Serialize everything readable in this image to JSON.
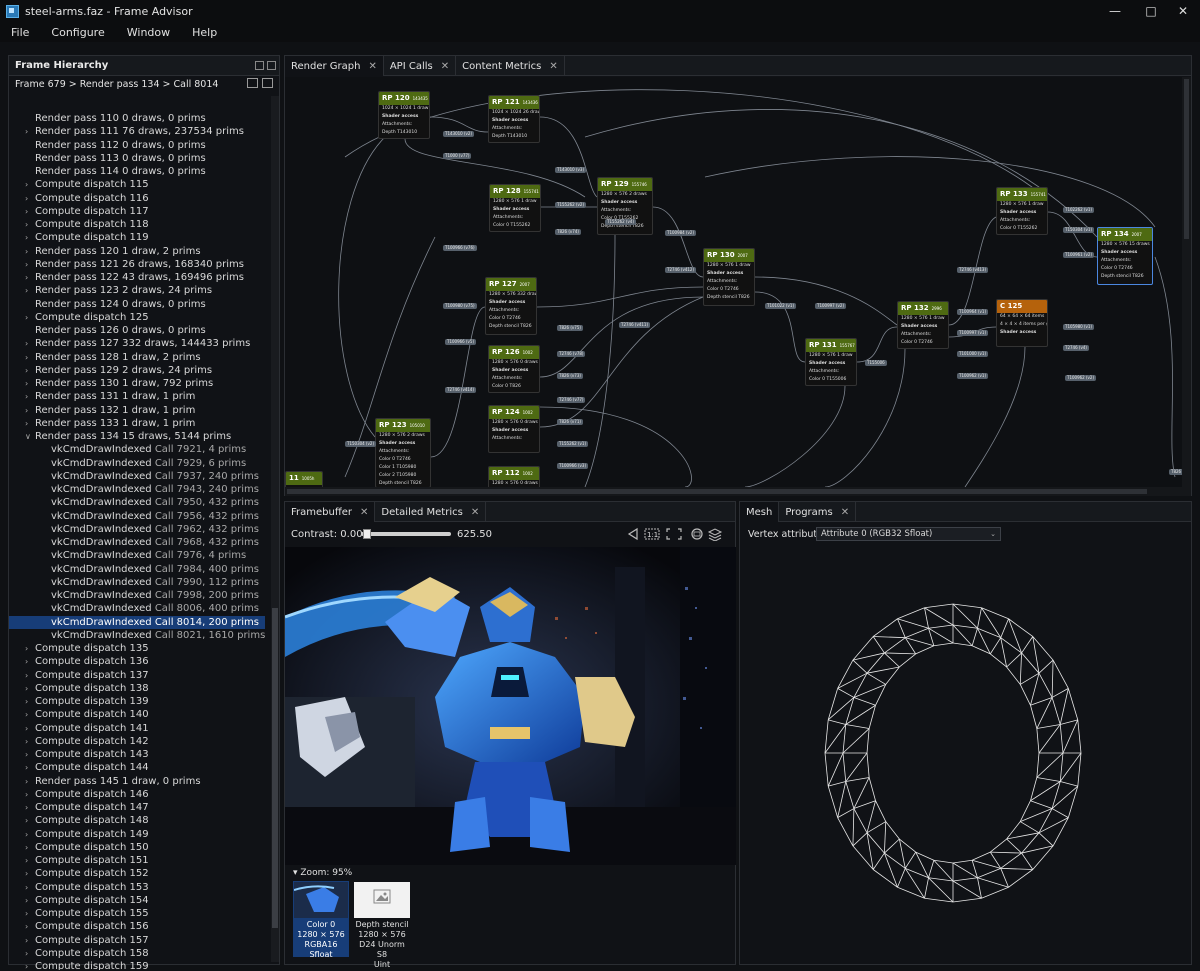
{
  "window": {
    "title": "steel-arms.faz - Frame Advisor"
  },
  "menu": [
    "File",
    "Configure",
    "Window",
    "Help"
  ],
  "hierarchy": {
    "title": "Frame Hierarchy",
    "breadcrumb": "Frame 679 > Render pass 134 > Call 8014",
    "rows": [
      {
        "label": "Render pass 110",
        "detail": "0 draws, 0 prims",
        "indent": 1,
        "expander": false
      },
      {
        "label": "Render pass 111",
        "detail": "76 draws, 237534 prims",
        "indent": 1,
        "expander": true
      },
      {
        "label": "Render pass 112",
        "detail": "0 draws, 0 prims",
        "indent": 1,
        "expander": false
      },
      {
        "label": "Render pass 113",
        "detail": "0 draws, 0 prims",
        "indent": 1,
        "expander": false
      },
      {
        "label": "Render pass 114",
        "detail": "0 draws, 0 prims",
        "indent": 1,
        "expander": false
      },
      {
        "label": "Compute dispatch 115",
        "detail": "",
        "indent": 1,
        "expander": true
      },
      {
        "label": "Compute dispatch 116",
        "detail": "",
        "indent": 1,
        "expander": true
      },
      {
        "label": "Compute dispatch 117",
        "detail": "",
        "indent": 1,
        "expander": true
      },
      {
        "label": "Compute dispatch 118",
        "detail": "",
        "indent": 1,
        "expander": true
      },
      {
        "label": "Compute dispatch 119",
        "detail": "",
        "indent": 1,
        "expander": true
      },
      {
        "label": "Render pass 120",
        "detail": "1 draw, 2 prims",
        "indent": 1,
        "expander": true
      },
      {
        "label": "Render pass 121",
        "detail": "26 draws, 168340 prims",
        "indent": 1,
        "expander": true
      },
      {
        "label": "Render pass 122",
        "detail": "43 draws, 169496 prims",
        "indent": 1,
        "expander": true
      },
      {
        "label": "Render pass 123",
        "detail": "2 draws, 24 prims",
        "indent": 1,
        "expander": true
      },
      {
        "label": "Render pass 124",
        "detail": "0 draws, 0 prims",
        "indent": 1,
        "expander": false
      },
      {
        "label": "Compute dispatch 125",
        "detail": "",
        "indent": 1,
        "expander": true
      },
      {
        "label": "Render pass 126",
        "detail": "0 draws, 0 prims",
        "indent": 1,
        "expander": false
      },
      {
        "label": "Render pass 127",
        "detail": "332 draws, 144433 prims",
        "indent": 1,
        "expander": true
      },
      {
        "label": "Render pass 128",
        "detail": "1 draw, 2 prims",
        "indent": 1,
        "expander": true
      },
      {
        "label": "Render pass 129",
        "detail": "2 draws, 24 prims",
        "indent": 1,
        "expander": true
      },
      {
        "label": "Render pass 130",
        "detail": "1 draw, 792 prims",
        "indent": 1,
        "expander": true
      },
      {
        "label": "Render pass 131",
        "detail": "1 draw, 1 prim",
        "indent": 1,
        "expander": true
      },
      {
        "label": "Render pass 132",
        "detail": "1 draw, 1 prim",
        "indent": 1,
        "expander": true
      },
      {
        "label": "Render pass 133",
        "detail": "1 draw, 1 prim",
        "indent": 1,
        "expander": true
      },
      {
        "label": "Render pass 134",
        "detail": "15 draws, 5144 prims",
        "indent": 1,
        "expander": "open"
      },
      {
        "label": "vkCmdDrawIndexed",
        "detail": "Call 7921, 4 prims",
        "indent": 2,
        "expander": false
      },
      {
        "label": "vkCmdDrawIndexed",
        "detail": "Call 7929, 6 prims",
        "indent": 2,
        "expander": false
      },
      {
        "label": "vkCmdDrawIndexed",
        "detail": "Call 7937, 240 prims",
        "indent": 2,
        "expander": false
      },
      {
        "label": "vkCmdDrawIndexed",
        "detail": "Call 7943, 240 prims",
        "indent": 2,
        "expander": false
      },
      {
        "label": "vkCmdDrawIndexed",
        "detail": "Call 7950, 432 prims",
        "indent": 2,
        "expander": false
      },
      {
        "label": "vkCmdDrawIndexed",
        "detail": "Call 7956, 432 prims",
        "indent": 2,
        "expander": false
      },
      {
        "label": "vkCmdDrawIndexed",
        "detail": "Call 7962, 432 prims",
        "indent": 2,
        "expander": false
      },
      {
        "label": "vkCmdDrawIndexed",
        "detail": "Call 7968, 432 prims",
        "indent": 2,
        "expander": false
      },
      {
        "label": "vkCmdDrawIndexed",
        "detail": "Call 7976, 4 prims",
        "indent": 2,
        "expander": false
      },
      {
        "label": "vkCmdDrawIndexed",
        "detail": "Call 7984, 400 prims",
        "indent": 2,
        "expander": false
      },
      {
        "label": "vkCmdDrawIndexed",
        "detail": "Call 7990, 112 prims",
        "indent": 2,
        "expander": false
      },
      {
        "label": "vkCmdDrawIndexed",
        "detail": "Call 7998, 200 prims",
        "indent": 2,
        "expander": false
      },
      {
        "label": "vkCmdDrawIndexed",
        "detail": "Call 8006, 400 prims",
        "indent": 2,
        "expander": false
      },
      {
        "label": "vkCmdDrawIndexed",
        "detail": "Call 8014, 200 prims",
        "indent": 2,
        "expander": false,
        "selected": true
      },
      {
        "label": "vkCmdDrawIndexed",
        "detail": "Call 8021, 1610 prims",
        "indent": 2,
        "expander": false
      },
      {
        "label": "Compute dispatch 135",
        "detail": "",
        "indent": 1,
        "expander": true
      },
      {
        "label": "Compute dispatch 136",
        "detail": "",
        "indent": 1,
        "expander": true
      },
      {
        "label": "Compute dispatch 137",
        "detail": "",
        "indent": 1,
        "expander": true
      },
      {
        "label": "Compute dispatch 138",
        "detail": "",
        "indent": 1,
        "expander": true
      },
      {
        "label": "Compute dispatch 139",
        "detail": "",
        "indent": 1,
        "expander": true
      },
      {
        "label": "Compute dispatch 140",
        "detail": "",
        "indent": 1,
        "expander": true
      },
      {
        "label": "Compute dispatch 141",
        "detail": "",
        "indent": 1,
        "expander": true
      },
      {
        "label": "Compute dispatch 142",
        "detail": "",
        "indent": 1,
        "expander": true
      },
      {
        "label": "Compute dispatch 143",
        "detail": "",
        "indent": 1,
        "expander": true
      },
      {
        "label": "Compute dispatch 144",
        "detail": "",
        "indent": 1,
        "expander": true
      },
      {
        "label": "Render pass 145",
        "detail": "1 draw, 0 prims",
        "indent": 1,
        "expander": true
      },
      {
        "label": "Compute dispatch 146",
        "detail": "",
        "indent": 1,
        "expander": true
      },
      {
        "label": "Compute dispatch 147",
        "detail": "",
        "indent": 1,
        "expander": true
      },
      {
        "label": "Compute dispatch 148",
        "detail": "",
        "indent": 1,
        "expander": true
      },
      {
        "label": "Compute dispatch 149",
        "detail": "",
        "indent": 1,
        "expander": true
      },
      {
        "label": "Compute dispatch 150",
        "detail": "",
        "indent": 1,
        "expander": true
      },
      {
        "label": "Compute dispatch 151",
        "detail": "",
        "indent": 1,
        "expander": true
      },
      {
        "label": "Compute dispatch 152",
        "detail": "",
        "indent": 1,
        "expander": true
      },
      {
        "label": "Compute dispatch 153",
        "detail": "",
        "indent": 1,
        "expander": true
      },
      {
        "label": "Compute dispatch 154",
        "detail": "",
        "indent": 1,
        "expander": true
      },
      {
        "label": "Compute dispatch 155",
        "detail": "",
        "indent": 1,
        "expander": true
      },
      {
        "label": "Compute dispatch 156",
        "detail": "",
        "indent": 1,
        "expander": true
      },
      {
        "label": "Compute dispatch 157",
        "detail": "",
        "indent": 1,
        "expander": true
      },
      {
        "label": "Compute dispatch 158",
        "detail": "",
        "indent": 1,
        "expander": true
      },
      {
        "label": "Compute dispatch 159",
        "detail": "",
        "indent": 1,
        "expander": true
      }
    ]
  },
  "graph_tabs": [
    "Render Graph",
    "API Calls",
    "Content Metrics"
  ],
  "graph_nodes": [
    {
      "id": "n120",
      "title": "RP 120",
      "sub": "143435",
      "kind": "rp",
      "lines": [
        "1024 × 1024   1 draw",
        "Shader access",
        "Attachments:",
        "Depth      T143010"
      ]
    },
    {
      "id": "n121",
      "title": "RP 121",
      "sub": "143436",
      "kind": "rp",
      "lines": [
        "1024 × 1024   26 draws",
        "Shader access",
        "Attachments:",
        "Depth      T143010"
      ]
    },
    {
      "id": "n128",
      "title": "RP 128",
      "sub": "155741",
      "kind": "rp",
      "lines": [
        "1280 × 576   1 draw",
        "Shader access",
        "Attachments:",
        "Color 0    T155262"
      ]
    },
    {
      "id": "n129",
      "title": "RP 129",
      "sub": "155746",
      "kind": "rp",
      "lines": [
        "1280 × 576   2 draws",
        "Shader access",
        "Attachments:",
        "Color 0    T155262",
        "Depth stencil  T826"
      ]
    },
    {
      "id": "n133",
      "title": "RP 133",
      "sub": "155741",
      "kind": "rp",
      "lines": [
        "1280 × 576   1 draw",
        "Shader access",
        "Attachments:",
        "Color 0    T155262"
      ]
    },
    {
      "id": "n134",
      "title": "RP 134",
      "sub": "2007",
      "kind": "rp",
      "lines": [
        "1280 × 576   15 draws",
        "Shader access",
        "Attachments:",
        "Color 0    T2746",
        "Depth stencil  T826"
      ]
    },
    {
      "id": "n130",
      "title": "RP 130",
      "sub": "2007",
      "kind": "rp",
      "lines": [
        "1280 × 576   1 draw",
        "Shader access",
        "Attachments:",
        "Color 0    T2746",
        "Depth stencil  T826"
      ]
    },
    {
      "id": "n127",
      "title": "RP 127",
      "sub": "2007",
      "kind": "rp",
      "lines": [
        "1280 × 576   332 draws",
        "Shader access",
        "Attachments:",
        "Color 0    T2746",
        "Depth stencil  T826"
      ]
    },
    {
      "id": "n126",
      "title": "RP 126",
      "sub": "1002",
      "kind": "rp",
      "lines": [
        "1280 × 576   0 draws",
        "Shader access",
        "Attachments:",
        "Color 0    T826"
      ]
    },
    {
      "id": "n124",
      "title": "RP 124",
      "sub": "1002",
      "kind": "rp",
      "lines": [
        "1280 × 576   0 draws",
        "Shader access",
        "Attachments:"
      ]
    },
    {
      "id": "n112",
      "title": "RP 112",
      "sub": "1002",
      "kind": "rp",
      "lines": [
        "1280 × 576   0 draws",
        "Shader access"
      ]
    },
    {
      "id": "n132",
      "title": "RP 132",
      "sub": "2996",
      "kind": "rp",
      "lines": [
        "1280 × 576   1 draw",
        "Shader access",
        "Attachments:",
        "Color 0    T2746"
      ]
    },
    {
      "id": "n131",
      "title": "RP 131",
      "sub": "155767",
      "kind": "rp",
      "lines": [
        "1280 × 576   1 draw",
        "Shader access",
        "Attachments:",
        "Color 0    T155006"
      ]
    },
    {
      "id": "n125",
      "title": "C 125",
      "sub": "",
      "kind": "cd",
      "lines": [
        "64 × 64 × 64 items",
        "4 × 4 × 4 items per group",
        "Shader access"
      ]
    },
    {
      "id": "n123",
      "title": "RP 123",
      "sub": "105010",
      "kind": "rp",
      "lines": [
        "1280 × 576   2 draws",
        "Shader access",
        "Attachments:",
        "Color 0    T2746",
        "Color 1    T105980",
        "Color 2    T105980",
        "Depth stencil  T826"
      ]
    },
    {
      "id": "n11",
      "title": "11",
      "sub": "1005h",
      "kind": "rp",
      "lines": []
    }
  ],
  "graph_labels": [
    "T143010 (v2)",
    "T1000 (v77)",
    "T143010 (v3)",
    "T155262 (v2)",
    "T826 (v74)",
    "T155262 (v4)",
    "T100966 (v76)",
    "T2746 (v412)",
    "T100980 (v75)",
    "T2746 (v411)",
    "T826 (v75)",
    "T2746 (v78)",
    "T826 (v73)",
    "T2746 (v77)",
    "T826 (v71)",
    "T155262 (v1)",
    "T100966 (v3)",
    "T155006",
    "T2746 (v413)",
    "T102262 (v1)",
    "T150304 (v1)",
    "T100961 (v2)",
    "T100964 (v1)",
    "T100997 (v1)",
    "T101000 (v1)",
    "T100962 (v1)",
    "T105980 (v1)",
    "T2746 (v4)",
    "T100962 (v2)",
    "T101022 (v1)",
    "T100997 (v2)",
    "T100966 (v5)",
    "T2746 (v414)",
    "T100984 (v2)",
    "T150304 (v2)",
    "T826 (v77)"
  ],
  "framebuffer": {
    "tabs": [
      "Framebuffer",
      "Detailed Metrics"
    ],
    "contrast_label": "Contrast:",
    "contrast_min": "0.00",
    "contrast_max": "625.50",
    "contrast_fraction": 0.04,
    "zoom": "Zoom: 95%",
    "thumbs": [
      {
        "lines": [
          "Color 0",
          "1280 × 576",
          "RGBA16 Sfloat"
        ],
        "selected": true
      },
      {
        "lines": [
          "Depth stencil",
          "1280 × 576",
          "D24 Unorm S8",
          "Uint"
        ],
        "selected": false
      }
    ]
  },
  "mesh": {
    "tabs": [
      "Mesh",
      "Programs"
    ],
    "attr_label": "Vertex attribute:",
    "attr_value": "Attribute 0 (RGB32 Sfloat)"
  },
  "colors": {
    "rp_header": "#4e6a12",
    "cd_header": "#b5620c",
    "selection": "#173d78",
    "accent": "#2a7ab8"
  }
}
